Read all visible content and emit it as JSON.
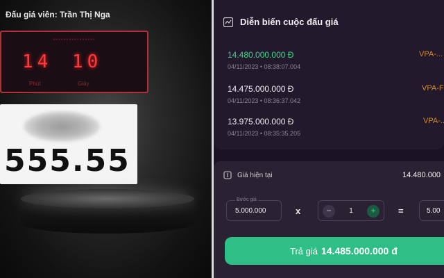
{
  "left": {
    "auctioneer": "Đấu giá viên: Trần Thị Nga",
    "timer": {
      "minutes": "14",
      "seconds": "10",
      "minutes_label": "Phút",
      "seconds_label": "Giây"
    },
    "plate_number": "555.55"
  },
  "history": {
    "title": "Diễn biến cuộc đấu giá",
    "icon": "chart-icon",
    "bids": [
      {
        "amount": "14.480.000.000 Đ",
        "time": "04/11/2023 • 08:38:07.004",
        "code": "VPA-..."
      },
      {
        "amount": "14.475.000.000 Đ",
        "time": "04/11/2023 • 08:36:37.042",
        "code": "VPA-F"
      },
      {
        "amount": "13.975.000.000 Đ",
        "time": "04/11/2023 • 08:35:35.205",
        "code": "VPA-..."
      }
    ]
  },
  "panel": {
    "current_label": "Giá hiện tại",
    "current_value": "14.480.000",
    "step_label": "Bước giá",
    "step_value": "5.000.000",
    "times": "x",
    "quantity": "1",
    "minus": "−",
    "plus": "+",
    "equals": "=",
    "total_value": "5.00",
    "bid_prefix": "Trả giá",
    "bid_amount": "14.485.000.000 đ"
  },
  "colors": {
    "accent_green": "#2fbf86",
    "highlight_green": "#3bd98a",
    "timer_red": "#ff3a3a",
    "code_orange": "#d48a2a"
  }
}
